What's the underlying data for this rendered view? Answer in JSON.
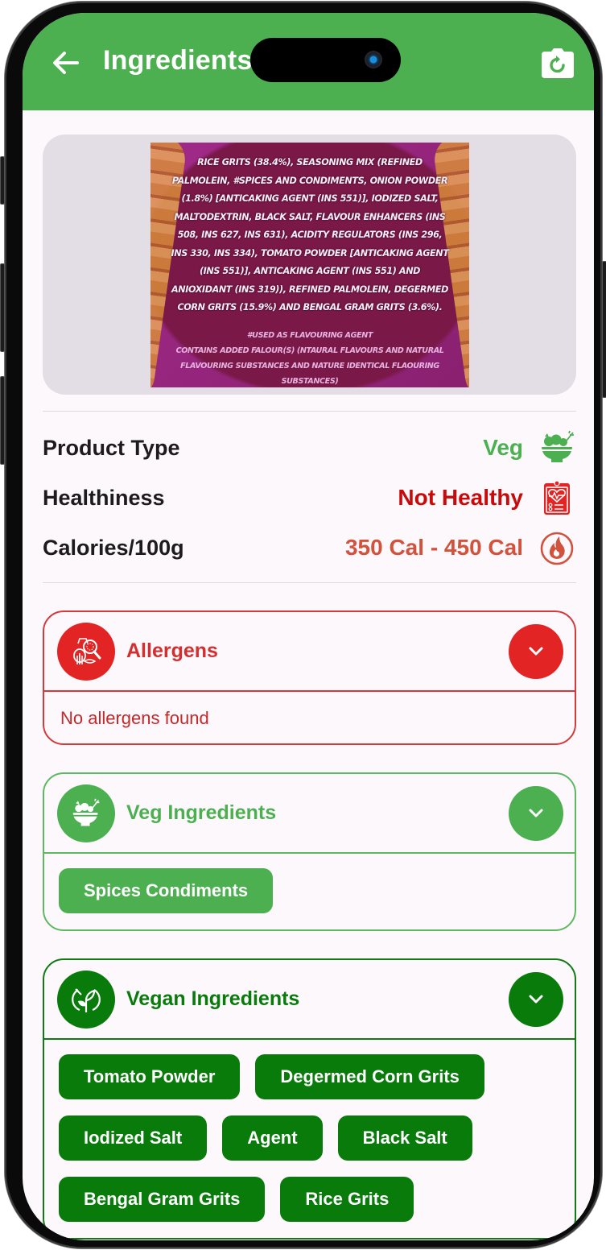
{
  "app": {
    "title": "Ingredients Analysis",
    "colors": {
      "primary": "#4caf50",
      "allergen": "#e32424",
      "veg": "#4caf50",
      "vegan": "#087b0b",
      "unhealthy": "#c90a0a",
      "calories": "#d2533d"
    }
  },
  "appbar": {
    "back_icon": "arrow-left-icon",
    "title": "Ingredients Analysis",
    "action_icon": "camera-retake-icon"
  },
  "label_image": {
    "ingredients_text": "RICE GRITS (38.4%), SEASONING MIX (REFINED PALMOLEIN, #SPICES AND CONDIMENTS, ONION POWDER (1.8%) [ANTICAKING AGENT (INS 551)], IODIZED SALT, MALTODEXTRIN, BLACK SALT, FLAVOUR ENHANCERS (INS 508, INS 627, INS 631), ACIDITY REGULATORS (INS 296, INS 330, INS 334), TOMATO POWDER [ANTICAKING AGENT (INS 551)], ANTICAKING AGENT (INS 551) AND ANIOXIDANT (INS 319)), REFINED PALMOLEIN, DEGERMED CORN GRITS (15.9%) AND BENGAL GRAM GRITS (3.6%).",
    "note_line1": "#USED AS FLAVOURING AGENT",
    "note_line2": "CONTAINS ADDED FALOUR(S) (NTAURAL FLAVOURS AND NATURAL FLAVOURING SUBSTANCES AND NATURE IDENTICAL FLAOURING SUBSTANCES)"
  },
  "info": [
    {
      "label": "Product Type",
      "value": "Veg",
      "icon": "veg-bowl-icon",
      "color": "#4caf50"
    },
    {
      "label": "Healthiness",
      "value": "Not Healthy",
      "icon": "health-report-icon",
      "color": "#c90a0a"
    },
    {
      "label": "Calories/100g",
      "value": "350 Cal - 450 Cal",
      "icon": "flame-icon",
      "color": "#d2533d"
    }
  ],
  "sections": {
    "allergens": {
      "title": "Allergens",
      "icon": "allergen-search-icon",
      "empty_text": "No allergens found"
    },
    "veg": {
      "title": "Veg Ingredients",
      "icon": "veg-bowl-icon",
      "chips": [
        "Spices Condiments"
      ]
    },
    "vegan": {
      "title": "Vegan Ingredients",
      "icon": "vegan-leaf-icon",
      "chips": [
        "Tomato Powder",
        "Degermed Corn Grits",
        "Iodized Salt",
        "Agent",
        "Black Salt",
        "Bengal Gram Grits",
        "Rice Grits"
      ]
    }
  }
}
